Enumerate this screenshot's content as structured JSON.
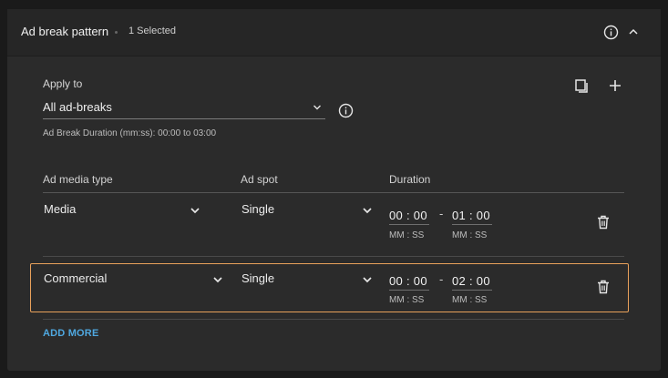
{
  "header": {
    "title": "Ad break pattern",
    "selected_count": "1 Selected"
  },
  "apply": {
    "label": "Apply to",
    "value": "All ad-breaks",
    "duration_hint": "Ad Break Duration (mm:ss): 00:00 to 03:00"
  },
  "columns": {
    "media_type": "Ad media type",
    "ad_spot": "Ad spot",
    "duration": "Duration"
  },
  "rows": [
    {
      "media_type": "Media",
      "ad_spot": "Single",
      "start": "00 : 00",
      "end": "01 : 00",
      "dash": "-",
      "unit": "MM : SS",
      "selected": false
    },
    {
      "media_type": "Commercial",
      "ad_spot": "Single",
      "start": "00 : 00",
      "end": "02 : 00",
      "dash": "-",
      "unit": "MM : SS",
      "selected": true
    }
  ],
  "footer": {
    "add_more": "ADD MORE"
  },
  "colors": {
    "selected_border": "#e8a15b",
    "link": "#4fa8e0"
  }
}
